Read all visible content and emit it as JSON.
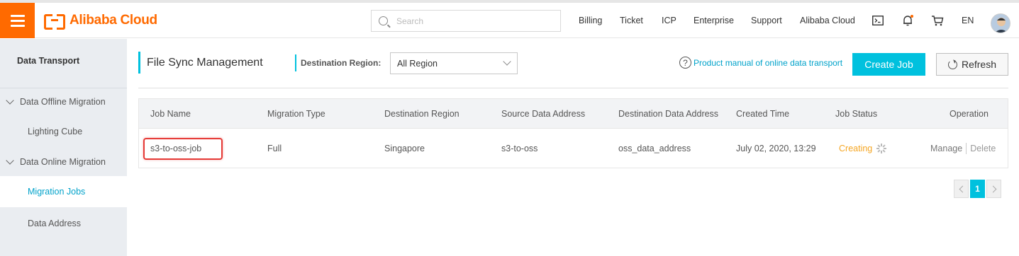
{
  "header": {
    "brand": "Alibaba Cloud",
    "search_placeholder": "Search",
    "nav": [
      "Billing",
      "Ticket",
      "ICP",
      "Enterprise",
      "Support",
      "Alibaba Cloud"
    ],
    "language": "EN",
    "icons": [
      "menu-icon",
      "terminal-icon",
      "bell-icon",
      "cart-icon"
    ],
    "brand_color": "#ff6a00",
    "notification_dot_color": "#ff6a00"
  },
  "sidebar": {
    "title": "Data Transport",
    "groups": [
      {
        "label": "Data Offline Migration",
        "items": [
          "Lighting Cube"
        ]
      },
      {
        "label": "Data Online Migration",
        "items": [
          "Migration Jobs",
          "Data Address"
        ]
      }
    ],
    "active_item": "Migration Jobs"
  },
  "main": {
    "title": "File Sync Management",
    "region_label": "Destination Region:",
    "region_value": "All Region",
    "manual_link": "Product manual of online data transport",
    "create_button": "Create Job",
    "refresh_button": "Refresh",
    "accent_color": "#00c1de"
  },
  "table": {
    "columns": [
      "Job Name",
      "Migration Type",
      "Destination Region",
      "Source Data Address",
      "Destination Data Address",
      "Created Time",
      "Job Status",
      "Operation"
    ],
    "rows": [
      {
        "job_name": "s3-to-oss-job",
        "migration_type": "Full",
        "destination_region": "Singapore",
        "source_address": "s3-to-oss",
        "destination_address": "oss_data_address",
        "created_time": "July 02, 2020, 13:29",
        "status": "Creating",
        "operations": [
          "Manage",
          "Delete"
        ]
      }
    ],
    "status_color": "#f5a623"
  },
  "pagination": {
    "current_page": "1"
  }
}
